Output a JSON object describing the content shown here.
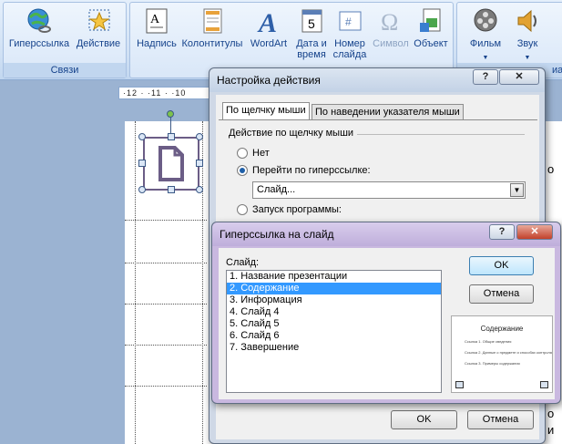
{
  "ribbon": {
    "groups": [
      {
        "label": "Связи",
        "buttons": [
          "Гиперссылка",
          "Действие"
        ]
      },
      {
        "label": "",
        "buttons": [
          "Надпись",
          "Колонтитулы",
          "WordArt",
          "Дата и время",
          "Номер слайда",
          "Символ",
          "Объект"
        ]
      },
      {
        "label": "",
        "buttons": [
          "Фильм",
          "Звук"
        ]
      }
    ],
    "btn_date_l1": "Дата и",
    "btn_date_l2": "время",
    "btn_num_l1": "Номер",
    "btn_num_l2": "слайда",
    "group3_tail": "иа"
  },
  "ruler": {
    "text": "·12 · ·11 · ·10"
  },
  "action_dialog": {
    "title": "Настройка действия",
    "help": "?",
    "close": "✕",
    "tabs": [
      "По щелчку мыши",
      "По наведении указателя мыши"
    ],
    "section": "Действие по щелчку мыши",
    "radio_none": "Нет",
    "radio_hyperlink": "Перейти по гиперссылке:",
    "hyperlink_value": "Слайд...",
    "radio_program": "Запуск программы:",
    "ok": "OK",
    "cancel": "Отмена"
  },
  "slide_dialog": {
    "title": "Гиперссылка на слайд",
    "help": "?",
    "close": "✕",
    "list_label": "Слайд:",
    "slides": [
      "1. Название презентации",
      "2. Содержание",
      "3. Информация",
      "4. Слайд 4",
      "5. Слайд 5",
      "6. Слайд 6",
      "7. Завершение"
    ],
    "selected_index": 1,
    "ok": "OK",
    "cancel": "Отмена",
    "preview_title": "Содержание",
    "preview_lines": [
      "Ссылка 1. Общие сведения",
      "Ссылка 2. Данные о предмете и способах контроля",
      "Ссылка 3. Примеры содержания"
    ]
  },
  "right_edge": {
    "letter1": "о",
    "letter2": "и"
  },
  "colors": {
    "ribbon_text": "#15428b",
    "selection": "#3399ff",
    "title_active": "#b9d1ea"
  }
}
